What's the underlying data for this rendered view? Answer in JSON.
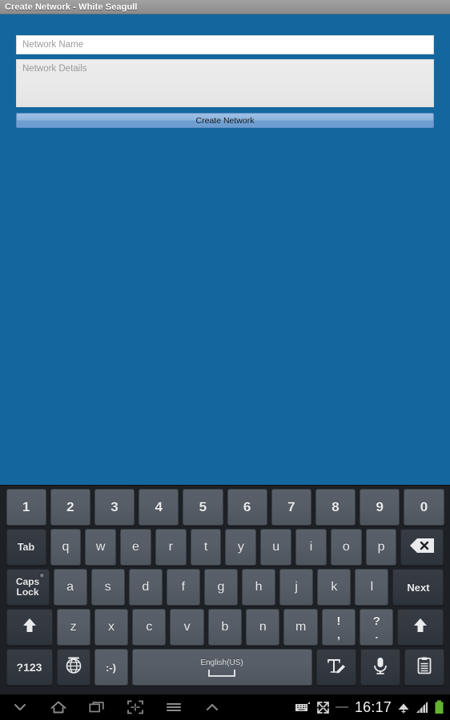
{
  "window": {
    "title": "Create Network - White Seagull"
  },
  "app": {
    "background_color": "#13679e",
    "form": {
      "network_name_placeholder": "Network Name",
      "network_name_value": "",
      "network_details_placeholder": "Network Details",
      "network_details_value": "",
      "create_button_label": "Create Network"
    }
  },
  "keyboard": {
    "language": "English(US)",
    "rows": {
      "numbers": [
        "1",
        "2",
        "3",
        "4",
        "5",
        "6",
        "7",
        "8",
        "9",
        "0"
      ],
      "top": {
        "tab": "Tab",
        "letters": [
          "q",
          "w",
          "e",
          "r",
          "t",
          "y",
          "u",
          "i",
          "o",
          "p"
        ],
        "backspace_icon": "backspace-icon"
      },
      "home": {
        "caps_lock_line1": "Caps",
        "caps_lock_line2": "Lock",
        "letters": [
          "a",
          "s",
          "d",
          "f",
          "g",
          "h",
          "j",
          "k",
          "l"
        ],
        "next": "Next"
      },
      "bottom": {
        "shift_left_icon": "shift-up-arrow-icon",
        "letters": [
          "z",
          "x",
          "c",
          "v",
          "b",
          "n",
          "m"
        ],
        "punct1_top": "!",
        "punct1_bottom": ",",
        "punct2_top": "?",
        "punct2_bottom": ".",
        "shift_right_icon": "shift-up-arrow-icon"
      },
      "function": {
        "symbols": "?123",
        "globe_icon": "globe-icon",
        "emoji": ":-)",
        "space_label": "English(US)",
        "handwriting_icon": "handwriting-icon",
        "mic_icon": "microphone-icon",
        "clipboard_icon": "clipboard-icon"
      }
    }
  },
  "system_bar": {
    "nav": {
      "hide_keyboard_icon": "chevron-down-icon",
      "home_icon": "home-icon",
      "recents_icon": "recent-apps-icon",
      "screenshot_icon": "screen-capture-icon",
      "menu_icon": "menu-icon",
      "expand_icon": "chevron-up-icon"
    },
    "status": {
      "keyboard_icon": "keyboard-icon",
      "fullscreen_icon": "fullscreen-icon",
      "separator": "—",
      "time": "16:17",
      "wifi_icon": "wifi-icon",
      "signal_icon": "cellular-signal-icon",
      "battery_icon": "battery-full-icon",
      "battery_color": "#64b42d"
    }
  }
}
